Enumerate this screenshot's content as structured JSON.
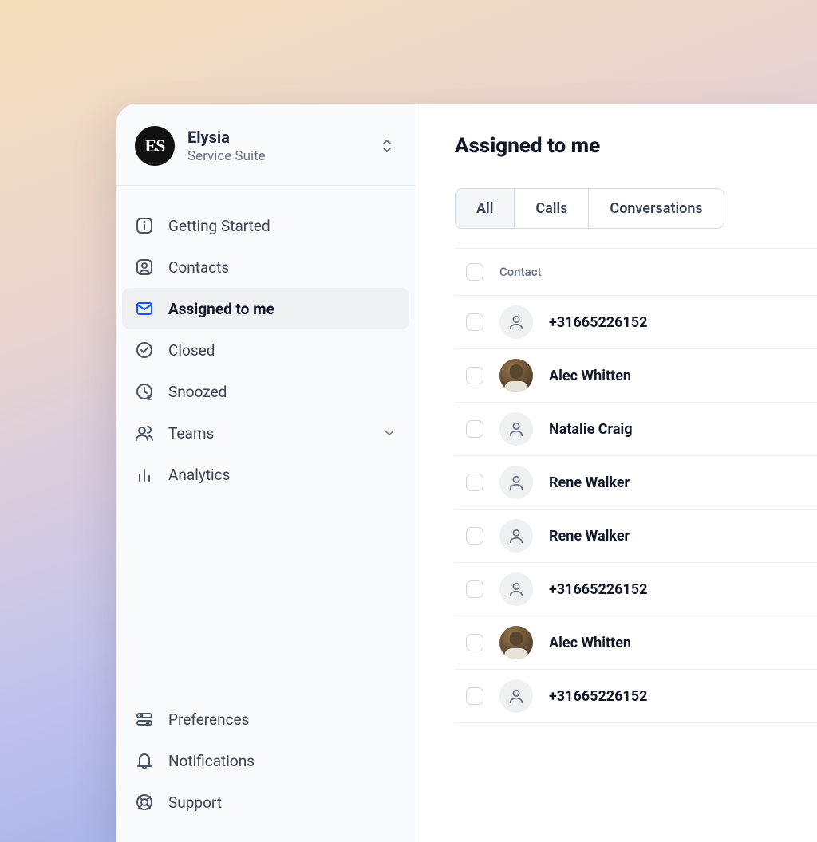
{
  "org": {
    "logoText": "ES",
    "name": "Elysia",
    "subtitle": "Service Suite"
  },
  "sidebar": {
    "top": [
      {
        "label": "Getting Started",
        "icon": "info"
      },
      {
        "label": "Contacts",
        "icon": "user-square"
      },
      {
        "label": "Assigned to me",
        "icon": "mail",
        "active": true
      },
      {
        "label": "Closed",
        "icon": "check-circle"
      },
      {
        "label": "Snoozed",
        "icon": "clock-snooze"
      },
      {
        "label": "Teams",
        "icon": "users",
        "expandable": true
      },
      {
        "label": "Analytics",
        "icon": "bar-chart"
      }
    ],
    "bottom": [
      {
        "label": "Preferences",
        "icon": "sliders"
      },
      {
        "label": "Notifications",
        "icon": "bell"
      },
      {
        "label": "Support",
        "icon": "lifebuoy"
      }
    ]
  },
  "main": {
    "title": "Assigned to me",
    "tabs": [
      {
        "label": "All",
        "active": true
      },
      {
        "label": "Calls"
      },
      {
        "label": "Conversations"
      }
    ],
    "columnHeader": "Contact",
    "rows": [
      {
        "name": "+31665226152",
        "avatar": "placeholder"
      },
      {
        "name": "Alec Whitten",
        "avatar": "photo"
      },
      {
        "name": "Natalie Craig",
        "avatar": "placeholder"
      },
      {
        "name": "Rene Walker",
        "avatar": "placeholder"
      },
      {
        "name": "Rene Walker",
        "avatar": "placeholder"
      },
      {
        "name": "+31665226152",
        "avatar": "placeholder"
      },
      {
        "name": "Alec Whitten",
        "avatar": "photo"
      },
      {
        "name": "+31665226152",
        "avatar": "placeholder"
      }
    ]
  }
}
